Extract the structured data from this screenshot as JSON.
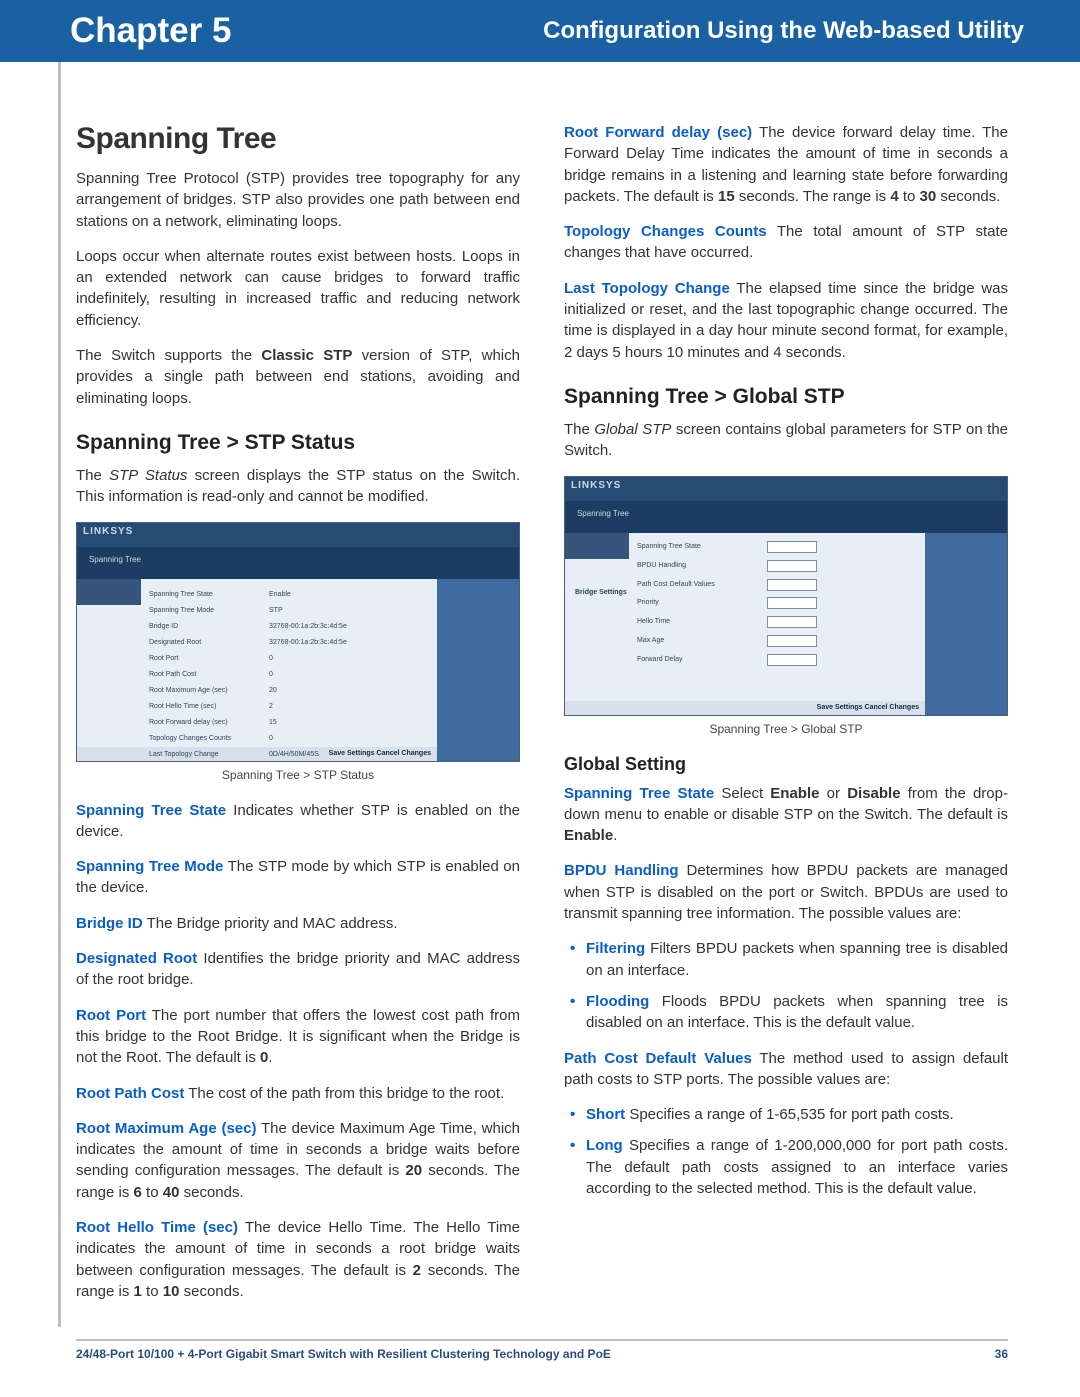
{
  "banner": {
    "chapter": "Chapter 5",
    "title": "Configuration Using the Web-based Utility"
  },
  "left": {
    "h1": "Spanning Tree",
    "p1": "Spanning Tree Protocol (STP) provides tree topography for any arrangement of bridges. STP also provides one path between end stations on a network, eliminating loops.",
    "p2": "Loops occur when alternate routes exist between hosts. Loops in an extended network can cause bridges to forward traffic indefinitely, resulting in increased traffic and reducing network efficiency.",
    "p3a": "The Switch supports the ",
    "p3b": "Classic STP",
    "p3c": " version of STP, which provides a single path between end stations, avoiding and eliminating loops.",
    "h2": "Spanning Tree > STP Status",
    "p4a": "The ",
    "p4b": "STP Status",
    "p4c": " screen displays the STP status on the Switch. This information is read-only and cannot be modified.",
    "fig1": {
      "logo": "LINKSYS",
      "tab": "Spanning Tree",
      "rows": [
        [
          "Spanning Tree State",
          "Enable"
        ],
        [
          "Spanning Tree Mode",
          "STP"
        ],
        [
          "Bridge ID",
          "32768-00:1a:2b:3c:4d:5e"
        ],
        [
          "Designated Root",
          "32768-00:1a:2b:3c:4d:5e"
        ],
        [
          "Root Port",
          "0"
        ],
        [
          "Root Path Cost",
          "0"
        ],
        [
          "Root Maximum Age (sec)",
          "20"
        ],
        [
          "Root Hello Time (sec)",
          "2"
        ],
        [
          "Root Forward delay (sec)",
          "15"
        ],
        [
          "Topology Changes Counts",
          "0"
        ],
        [
          "Last Topology Change",
          "0D/4H/50M/45S"
        ]
      ],
      "btns": "Save Settings   Cancel Changes"
    },
    "cap1": "Spanning Tree > STP Status",
    "d1t": "Spanning Tree State",
    "d1": "  Indicates whether STP is enabled on the device.",
    "d2t": "Spanning Tree Mode",
    "d2": "  The STP mode by which STP is enabled on the device.",
    "d3t": "Bridge ID",
    "d3": "  The Bridge priority and MAC address.",
    "d4t": "Designated Root",
    "d4": "  Identifies the bridge priority and MAC address of the root bridge.",
    "d5t": "Root Port",
    "d5a": "  The port number that offers the lowest cost path from this bridge to the Root Bridge. It is significant when the Bridge is not the Root. The default is ",
    "d5b": "0",
    "d5c": ".",
    "d6t": "Root Path Cost",
    "d6": "  The cost of the path from this bridge to the root.",
    "d7t": "Root Maximum Age (sec)",
    "d7a": " The device Maximum Age Time, which indicates the amount of time in seconds a bridge waits before sending configuration messages. The default is ",
    "d7b": "20",
    "d7c": " seconds. The range is ",
    "d7d": "6",
    "d7e": " to ",
    "d7f": "40",
    "d7g": " seconds.",
    "d8t": "Root Hello Time (sec)",
    "d8a": "  The device Hello Time. The Hello Time indicates the amount of time in seconds a root bridge waits between configuration messages. The default is ",
    "d8b": "2",
    "d8c": " seconds. The range is ",
    "d8d": "1",
    "d8e": " to ",
    "d8f": "10",
    "d8g": " seconds."
  },
  "right": {
    "d9t": "Root Forward delay (sec)",
    "d9a": "  The device forward delay time. The Forward Delay Time indicates the amount of time in seconds a bridge remains in a listening and learning state before forwarding packets. The default is ",
    "d9b": "15",
    "d9c": " seconds. The range is ",
    "d9d": "4",
    "d9e": " to ",
    "d9f": "30",
    "d9g": " seconds.",
    "d10t": "Topology Changes Counts",
    "d10": " The total amount of STP state changes that have occurred.",
    "d11t": "Last Topology Change",
    "d11": "  The elapsed time since the bridge was initialized or reset, and the last topographic change occurred. The time is displayed in a day hour minute second format, for example, 2 days 5 hours 10 minutes and 4 seconds.",
    "h2": "Spanning Tree > Global STP",
    "p1a": "The ",
    "p1b": "Global STP",
    "p1c": " screen contains global parameters for STP on the Switch.",
    "fig2": {
      "logo": "LINKSYS",
      "tab": "Spanning Tree",
      "f1k": "Spanning Tree State",
      "f2k": "BPDU Handling",
      "f3k": "Path Cost Default Values",
      "bh": "Bridge Settings",
      "g1": "Priority",
      "g2": "Hello Time",
      "g3": "Max Age",
      "g4": "Forward Delay",
      "btns": "Save Settings   Cancel Changes"
    },
    "cap2": "Spanning Tree > Global STP",
    "h3": "Global Setting",
    "g1t": "Spanning Tree State",
    "g1a": "  Select ",
    "g1b": "Enable",
    "g1c": " or ",
    "g1d": "Disable",
    "g1e": " from the drop-down menu to enable or disable STP on the Switch. The default is ",
    "g1f": "Enable",
    "g1g": ".",
    "g2t": "BPDU Handling",
    "g2": " Determines how BPDU packets are managed when STP is disabled on the port or Switch. BPDUs are used to transmit spanning tree information. The possible values are:",
    "b1t": "Filtering",
    "b1": "  Filters BPDU packets when spanning tree is disabled on an interface.",
    "b2t": "Flooding",
    "b2": "  Floods BPDU packets when spanning tree is disabled on an interface. This is the default value.",
    "g3t": "Path Cost Default Values",
    "g3": "  The method used to assign default path costs to STP ports. The possible values are:",
    "b3t": "Short",
    "b3": "  Specifies a range of 1-65,535 for port path costs.",
    "b4t": "Long",
    "b4": "  Specifies a range of 1-200,000,000 for port path costs. The default path costs assigned to an interface varies according to the selected method. This is the default value."
  },
  "footer": {
    "product": "24/48-Port 10/100 + 4-Port Gigabit Smart Switch with Resilient Clustering Technology and PoE",
    "page": "36"
  }
}
